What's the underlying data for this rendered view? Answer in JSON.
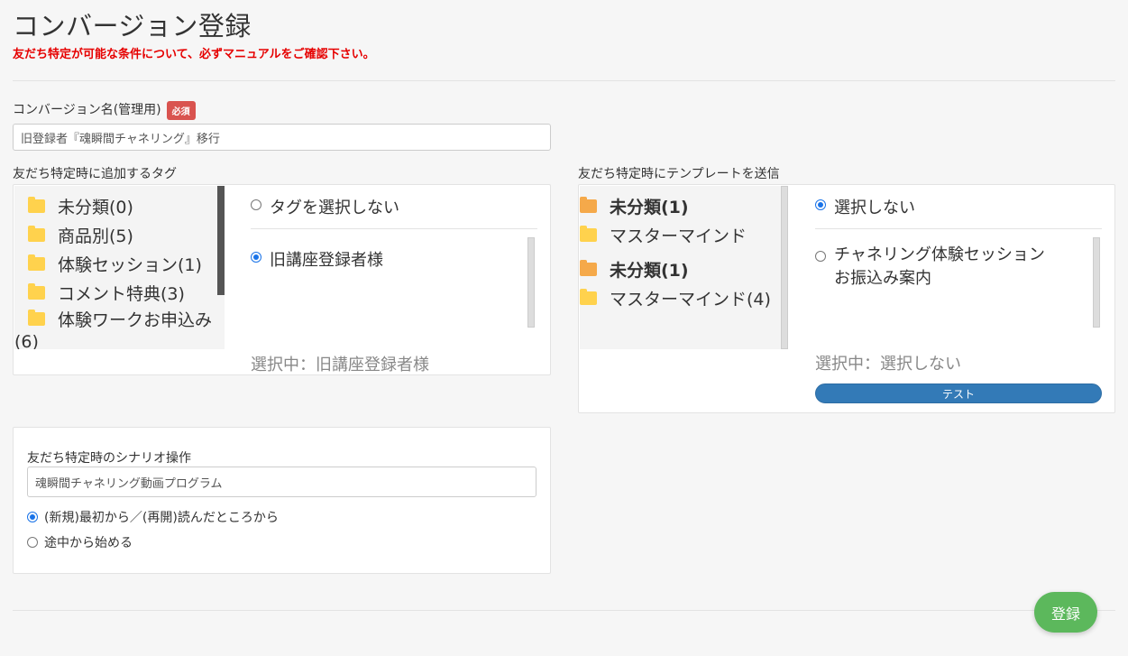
{
  "page": {
    "title": "コンバージョン登録",
    "warning": "友だち特定が可能な条件について、必ずマニュアルをご確認下さい。"
  },
  "conversion_name": {
    "label": "コンバージョン名(管理用)",
    "required_badge": "必須",
    "value": "旧登録者『魂瞬間チャネリング』移行"
  },
  "tag_section": {
    "label": "友だち特定時に追加するタグ",
    "folders": [
      {
        "label": "未分類(0)"
      },
      {
        "label": "商品別(5)"
      },
      {
        "label": "体験セッション(1)"
      },
      {
        "label": "コメント特典(3)"
      },
      {
        "label": "体験ワークお申込み"
      },
      {
        "label": "(6)"
      }
    ],
    "option_none": "タグを選択しない",
    "options": [
      {
        "label": "旧講座登録者様",
        "checked": true
      }
    ],
    "selected_text": "選択中：旧講座登録者様"
  },
  "template_section": {
    "label": "友だち特定時にテンプレートを送信",
    "folders": [
      {
        "label": "未分類(1)",
        "open": true
      },
      {
        "label": "マスターマインド",
        "open": false
      },
      {
        "label": "未分類(1)",
        "open": true
      },
      {
        "label": "マスターマインド(4)",
        "open": false
      }
    ],
    "option_none": "選択しない",
    "options": [
      {
        "line1": "チャネリング体験セッション",
        "line2": "お振込み案内",
        "checked": false
      }
    ],
    "selected_text": "選択中：選択しない",
    "test_button": "テスト"
  },
  "scenario_section": {
    "label": "友だち特定時のシナリオ操作",
    "value": "魂瞬間チャネリング動画プログラム",
    "option1": "(新規)最初から／(再開)読んだところから",
    "option2": "途中から始める"
  },
  "submit_button": "登録",
  "colors": {
    "warning": "#e60000",
    "primary": "#337ab7",
    "success": "#5cb85c",
    "badge": "#d9534f"
  }
}
